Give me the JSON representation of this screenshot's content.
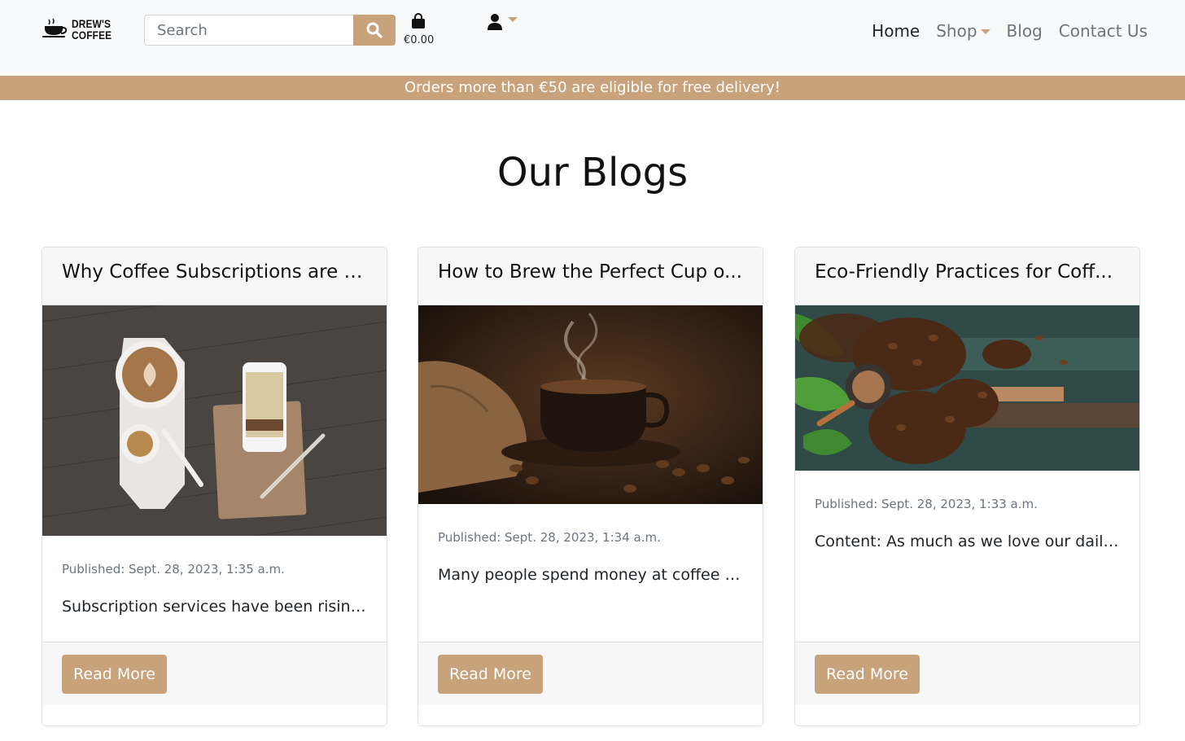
{
  "brand": {
    "line1": "DREW'S",
    "line2": "COFFEE",
    "accent": "#c8a27a"
  },
  "search": {
    "placeholder": "Search",
    "value": ""
  },
  "cart": {
    "total": "€0.00"
  },
  "nav": {
    "home": "Home",
    "shop": "Shop",
    "blog": "Blog",
    "contact": "Contact Us"
  },
  "banner": {
    "text": "Orders more than €50 are eligible for free delivery!"
  },
  "page": {
    "title": "Our Blogs"
  },
  "posts": [
    {
      "title": "Why Coffee Subscriptions are t...",
      "published": "Published: Sept. 28, 2023, 1:35 a.m.",
      "excerpt": "Subscription services have been rising in...",
      "button": "Read More",
      "image": "latte-notebook-phone-on-wood"
    },
    {
      "title": "How to Brew the Perfect Cup o...",
      "published": "Published: Sept. 28, 2023, 1:34 a.m.",
      "excerpt": "Many people spend money at coffee sh...",
      "button": "Read More",
      "image": "steaming-coffee-cup-with-beans"
    },
    {
      "title": "Eco-Friendly Practices for Coff...",
      "published": "Published: Sept. 28, 2023, 1:33 a.m.",
      "excerpt": "Content: As much as we love our daily c...",
      "button": "Read More",
      "image": "coffee-beans-and-turkish-pot"
    }
  ]
}
